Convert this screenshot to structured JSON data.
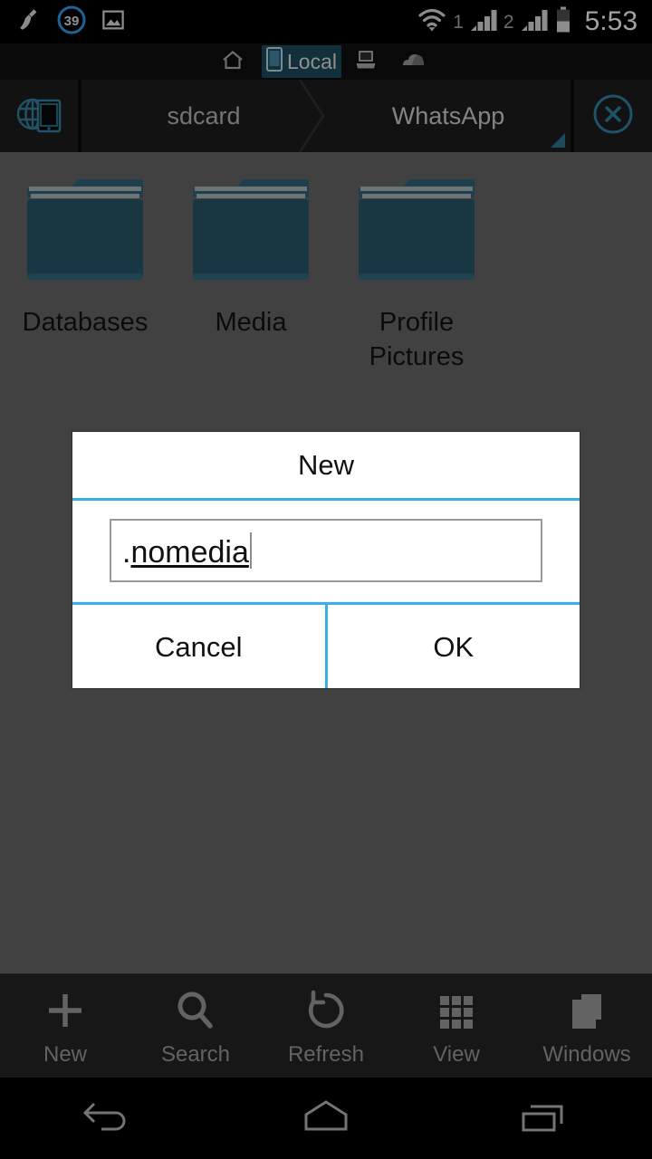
{
  "status_bar": {
    "icons": [
      "broom-icon",
      "badge-count-icon",
      "gallery-icon"
    ],
    "badge_count": "39",
    "sim1_label": "1",
    "sim2_label": "2",
    "wifi_icon": "wifi-icon",
    "battery_icon": "battery-icon",
    "time": "5:53"
  },
  "tab_strip": {
    "tabs": [
      {
        "label": "",
        "icon": "home-icon",
        "active": false
      },
      {
        "label": "Local",
        "icon": "phone-icon",
        "active": true
      },
      {
        "label": "",
        "icon": "computer-icon",
        "active": false
      },
      {
        "label": "",
        "icon": "cloud-icon",
        "active": false
      }
    ]
  },
  "breadcrumb": {
    "home_icon": "globe-device-icon",
    "segments": [
      {
        "label": "sdcard",
        "active": false
      },
      {
        "label": "WhatsApp",
        "active": true
      }
    ],
    "close_icon": "close-circle-icon"
  },
  "files": {
    "items": [
      {
        "name": "Databases",
        "icon": "folder-icon"
      },
      {
        "name": "Media",
        "icon": "folder-icon"
      },
      {
        "name": "Profile Pictures",
        "icon": "folder-icon"
      }
    ]
  },
  "dialog": {
    "title": "New",
    "input_prefix": ".",
    "input_composing": "nomedia",
    "input_value": ".nomedia",
    "input_placeholder": "",
    "cancel_label": "Cancel",
    "ok_label": "OK"
  },
  "toolbar": {
    "items": [
      {
        "label": "New",
        "icon": "plus-icon"
      },
      {
        "label": "Search",
        "icon": "search-icon"
      },
      {
        "label": "Refresh",
        "icon": "refresh-icon"
      },
      {
        "label": "View",
        "icon": "grid-icon"
      },
      {
        "label": "Windows",
        "icon": "windows-icon"
      }
    ]
  },
  "navbar": {
    "items": [
      {
        "icon": "back-icon"
      },
      {
        "icon": "home-nav-icon"
      },
      {
        "icon": "recents-icon"
      }
    ]
  },
  "colors": {
    "background": "#5e5e5e",
    "folder_teal": "#25505f",
    "accent_blue": "#38b0e8",
    "tab_active_bg": "#1b4557",
    "toolbar_bg": "#212121",
    "icon_teal": "#2a6b86"
  }
}
